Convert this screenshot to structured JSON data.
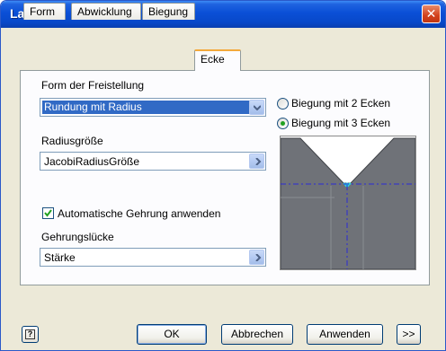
{
  "window": {
    "title": "Lasche",
    "close_glyph": "✕"
  },
  "tabs": [
    {
      "label": "Form"
    },
    {
      "label": "Abwicklung"
    },
    {
      "label": "Biegung"
    },
    {
      "label": "Ecke"
    }
  ],
  "form": {
    "relief_shape_label": "Form der Freistellung",
    "relief_shape_value": "Rundung mit Radius",
    "radius_size_label": "Radiusgröße",
    "radius_size_value": "JacobiRadiusGröße",
    "auto_miter_label": "Automatische Gehrung anwenden",
    "auto_miter_checked": true,
    "miter_gap_label": "Gehrungslücke",
    "miter_gap_value": "Stärke"
  },
  "corner_options": [
    {
      "label": "Biegung mit 2 Ecken",
      "selected": false
    },
    {
      "label": "Biegung mit 3 Ecken",
      "selected": true
    }
  ],
  "buttons": {
    "help": "?",
    "ok": "OK",
    "cancel": "Abbrechen",
    "apply": "Anwenden",
    "more": ">>"
  },
  "colors": {
    "titlebar": "#0a4fd6",
    "selection": "#316ac5",
    "preview_fill": "#6f7278",
    "preview_axis": "#2b2bd6",
    "preview_point": "#2ad6e0"
  }
}
